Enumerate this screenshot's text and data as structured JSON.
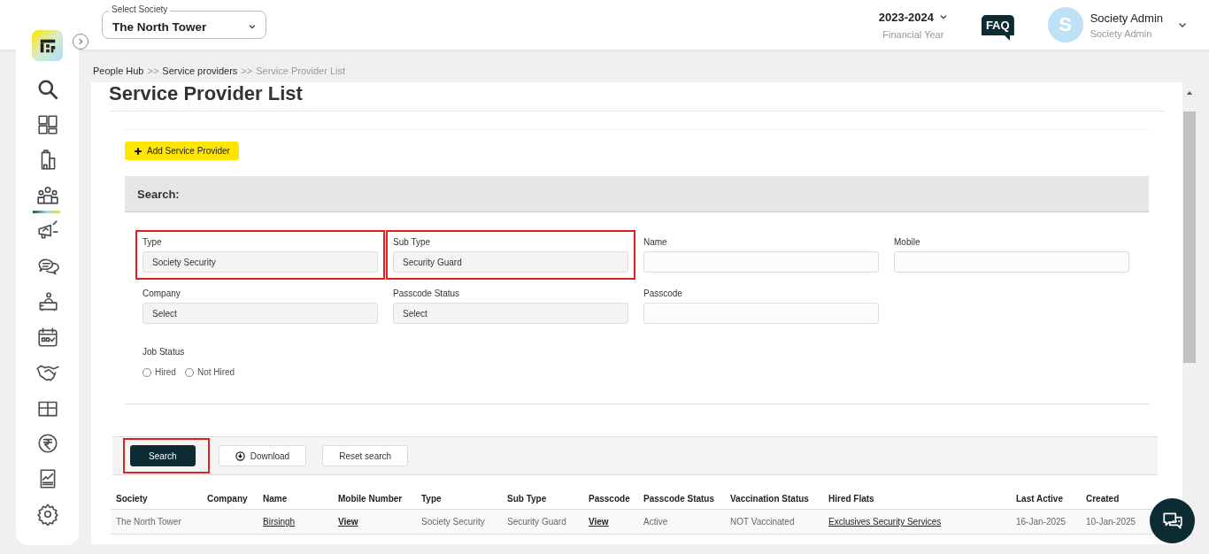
{
  "header": {
    "society_select": {
      "label": "Select Society",
      "value": "The North Tower"
    },
    "financial_year": {
      "value": "2023-2024",
      "label": "Financial Year"
    },
    "faq": "FAQ",
    "user": {
      "initial": "S",
      "name": "Society Admin",
      "role": "Society Admin"
    }
  },
  "sidebar": {
    "items": [
      {
        "kind": "search",
        "selected": false
      },
      {
        "kind": "dashboard",
        "selected": false
      },
      {
        "kind": "building",
        "selected": false
      },
      {
        "kind": "people",
        "selected": true
      },
      {
        "kind": "megaphone",
        "selected": false
      },
      {
        "kind": "chat",
        "selected": false
      },
      {
        "kind": "desk",
        "selected": false
      },
      {
        "kind": "calendar",
        "selected": false
      },
      {
        "kind": "handshake",
        "selected": false
      },
      {
        "kind": "box",
        "selected": false
      },
      {
        "kind": "rupee",
        "selected": false
      },
      {
        "kind": "report",
        "selected": false
      },
      {
        "kind": "settings",
        "selected": false
      }
    ]
  },
  "breadcrumb": [
    {
      "label": "People Hub",
      "current": false
    },
    {
      "label": "Service providers",
      "current": false
    },
    {
      "label": "Service Provider List",
      "current": true
    }
  ],
  "breadcrumb_separator": ">>",
  "page_title": "Service Provider List",
  "add_button": "Add Service Provider",
  "search_panel": {
    "title": "Search:",
    "fields": [
      {
        "label": "Type",
        "kind": "select",
        "value": "Society Security",
        "highlighted": true
      },
      {
        "label": "Sub Type",
        "kind": "select",
        "value": "Security Guard",
        "highlighted": true
      },
      {
        "label": "Name",
        "kind": "text",
        "highlighted": false
      },
      {
        "label": "Mobile",
        "kind": "text",
        "highlighted": false
      },
      {
        "label": "Company",
        "kind": "select",
        "value": "Select",
        "highlighted": false
      },
      {
        "label": "Passcode Status",
        "kind": "select",
        "value": "Select",
        "highlighted": false
      },
      {
        "label": "Passcode",
        "kind": "text",
        "highlighted": false
      }
    ],
    "job_status": {
      "label": "Job Status",
      "options": [
        {
          "label": "Hired",
          "selected": false
        },
        {
          "label": "Not Hired",
          "selected": false
        }
      ]
    }
  },
  "actions": [
    {
      "label": "Search",
      "kind": "primary",
      "highlighted": true
    },
    {
      "label": "Download",
      "kind": "download",
      "highlighted": false
    },
    {
      "label": "Reset search",
      "kind": "plain",
      "highlighted": false
    }
  ],
  "table": {
    "columns": [
      "Society",
      "Company",
      "Name",
      "Mobile Number",
      "Type",
      "Sub Type",
      "Passcode",
      "Passcode Status",
      "Vaccination Status",
      "Hired Flats",
      "Last Active",
      "Created"
    ],
    "rows": [
      [
        {
          "text": "The North Tower",
          "link": false
        },
        null,
        {
          "text": "Birsingh",
          "link": true
        },
        {
          "text": "View",
          "link": true
        },
        {
          "text": "Society Security",
          "link": false
        },
        {
          "text": "Security Guard",
          "link": false
        },
        {
          "text": "View",
          "link": true
        },
        {
          "text": "Active",
          "link": false
        },
        {
          "text": "NOT Vaccinated",
          "link": false
        },
        {
          "text": "Exclusives Security Services",
          "link": true
        },
        {
          "text": "16-Jan-2025",
          "link": false
        },
        {
          "text": "10-Jan-2025",
          "link": false
        }
      ]
    ]
  }
}
